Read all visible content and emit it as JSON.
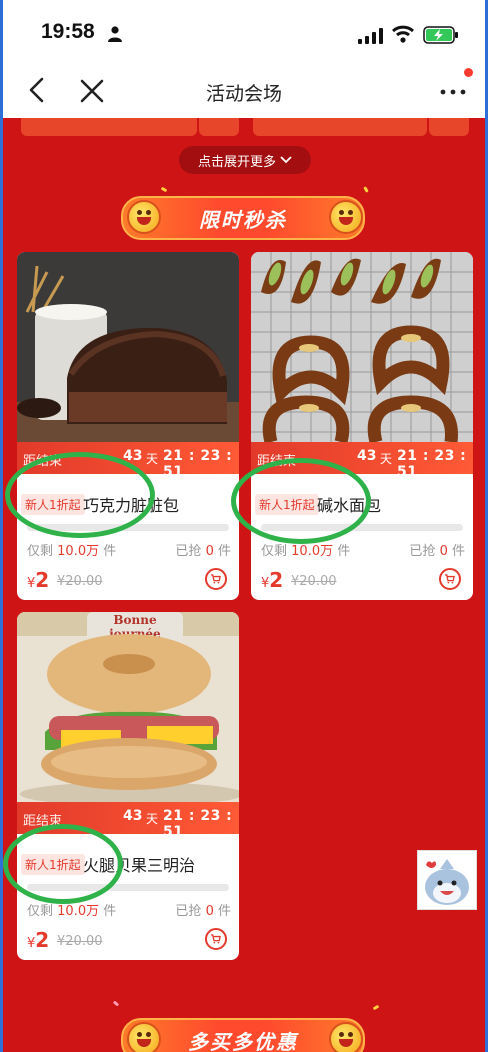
{
  "status_bar": {
    "time": "19:58"
  },
  "nav": {
    "title": "活动会场"
  },
  "expand_more": "点击展开更多",
  "section_flash": "限时秒杀",
  "section_bulk": "多买多优惠",
  "products": [
    {
      "name": "巧克力脏脏包",
      "tag": "新人1折起",
      "countdown_label": "距结束",
      "days": "43",
      "day_unit": "天",
      "time": "21 : 23 : 51",
      "stock_prefix": "仅剩",
      "stock_value": "10.0万",
      "stock_unit": "件",
      "sold_prefix": "已抢",
      "sold_value": "0",
      "sold_unit": "件",
      "currency": "¥",
      "price": "2",
      "original_price": "¥20.00",
      "sold_fraction": 0
    },
    {
      "name": "碱水面包",
      "tag": "新人1折起",
      "countdown_label": "距结束",
      "days": "43",
      "day_unit": "天",
      "time": "21 : 23 : 51",
      "stock_prefix": "仅剩",
      "stock_value": "10.0万",
      "stock_unit": "件",
      "sold_prefix": "已抢",
      "sold_value": "0",
      "sold_unit": "件",
      "currency": "¥",
      "price": "2",
      "original_price": "¥20.00",
      "sold_fraction": 0
    },
    {
      "name": "火腿贝果三明治",
      "tag": "新人1折起",
      "countdown_label": "距结束",
      "days": "43",
      "day_unit": "天",
      "time": "21 : 23 : 51",
      "stock_prefix": "仅剩",
      "stock_value": "10.0万",
      "stock_unit": "件",
      "sold_prefix": "已抢",
      "sold_value": "0",
      "sold_unit": "件",
      "currency": "¥",
      "price": "2",
      "original_price": "¥20.00",
      "sold_fraction": 0,
      "mug_text": "bonne journée"
    }
  ],
  "colors": {
    "page_red": "#cf1415",
    "accent": "#e43a2c",
    "circle_annotation": "#2fb24a"
  },
  "icons": [
    "person-icon",
    "signal-icon",
    "wifi-icon",
    "battery-charging-icon",
    "back-icon",
    "close-icon",
    "more-icon",
    "chevron-down-icon",
    "cart-icon",
    "mascot-sticker"
  ]
}
